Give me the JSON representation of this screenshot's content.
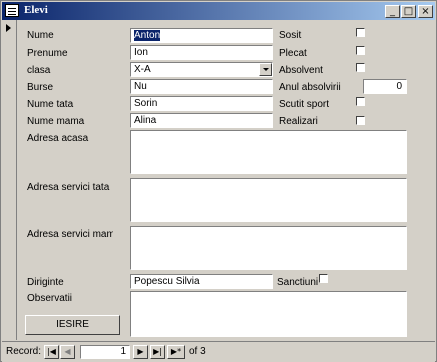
{
  "window": {
    "title": "Elevi"
  },
  "fields": {
    "nume": {
      "label": "Nume",
      "value": "Anton"
    },
    "prenume": {
      "label": "Prenume",
      "value": "Ion"
    },
    "clasa": {
      "label": "clasa",
      "value": "X-A"
    },
    "burse": {
      "label": "Burse",
      "value": "Nu"
    },
    "nume_tata": {
      "label": "Nume tata",
      "value": "Sorin"
    },
    "nume_mama": {
      "label": "Nume mama",
      "value": "Alina"
    },
    "adresa_acasa": {
      "label": "Adresa acasa",
      "value": ""
    },
    "adresa_servici_tata": {
      "label": "Adresa servici tata",
      "value": ""
    },
    "adresa_servici_mama": {
      "label": "Adresa servici mama",
      "value": ""
    },
    "diriginte": {
      "label": "Diriginte",
      "value": "Popescu Silvia"
    },
    "observatii": {
      "label": "Observatii",
      "value": ""
    }
  },
  "checks": {
    "sosit": {
      "label": "Sosit",
      "checked": false
    },
    "plecat": {
      "label": "Plecat",
      "checked": false
    },
    "absolvent": {
      "label": "Absolvent",
      "checked": false
    },
    "scutit_sport": {
      "label": "Scutit sport",
      "checked": false
    },
    "realizari": {
      "label": "Realizari",
      "checked": false
    },
    "sanctiuni": {
      "label": "Sanctiuni",
      "checked": false
    }
  },
  "anul_absolvirii": {
    "label": "Anul absolvirii",
    "value": "0"
  },
  "exit_button": {
    "label": "IESIRE"
  },
  "navigation": {
    "record_label": "Record:",
    "current": "1",
    "of_label": "of 3"
  }
}
